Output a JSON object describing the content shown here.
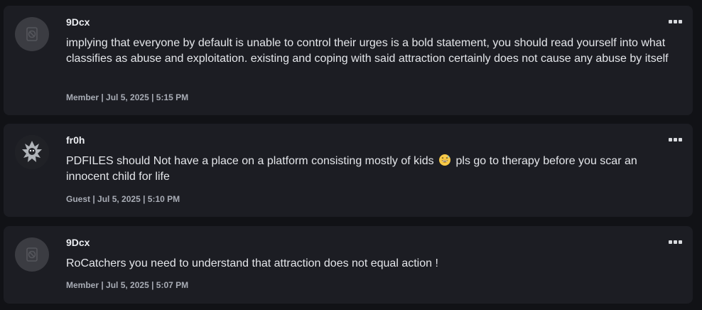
{
  "comments": [
    {
      "username": "9Dcx",
      "text": "implying that everyone by default is unable to control their urges is a bold statement, you should read yourself into what classifies as abuse and exploitation. existing and coping with said attraction certainly does not cause any abuse by itself",
      "meta": "Member | Jul 5, 2025 | 5:15 PM",
      "avatar_icon": "default-avatar-icon"
    },
    {
      "username": "fr0h",
      "text_before_emoji": "PDFILES should Not have a place on a platform consisting mostly of kids",
      "emoji": "grinning-sweat-emoji",
      "text_after_emoji": "pls go to therapy before you scar an innocent child for life",
      "meta": "Guest | Jul 5, 2025 | 5:10 PM",
      "avatar_icon": "user-photo-avatar"
    },
    {
      "username": "9Dcx",
      "text": "RoCatchers you need to understand that attraction does not equal action !",
      "meta": "Member | Jul 5, 2025 | 5:07 PM",
      "avatar_icon": "default-avatar-icon"
    }
  ],
  "colors": {
    "background": "#111216",
    "card": "#1c1d23",
    "text": "#e4e6ea",
    "meta": "#a8acb5"
  }
}
